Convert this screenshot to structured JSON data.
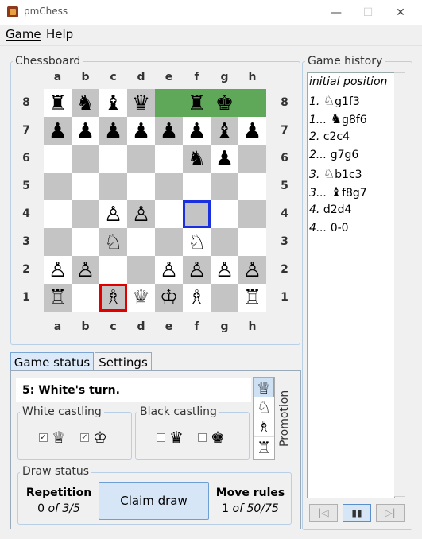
{
  "window": {
    "title": "pmChess",
    "minimize": "—",
    "maximize": "☐",
    "close": "✕"
  },
  "menu": {
    "game": "Game",
    "help": "Help"
  },
  "board": {
    "title": "Chessboard",
    "files": [
      "a",
      "b",
      "c",
      "d",
      "e",
      "f",
      "g",
      "h"
    ],
    "ranks": [
      "8",
      "7",
      "6",
      "5",
      "4",
      "3",
      "2",
      "1"
    ],
    "squares": [
      [
        "♜",
        "♞",
        "♝",
        "♛",
        "",
        "♜",
        "♚",
        ""
      ],
      [
        "♟",
        "♟",
        "♟",
        "♟",
        "♟",
        "♟",
        "♝",
        "♟"
      ],
      [
        "",
        "",
        "",
        "",
        "",
        "♞",
        "♟",
        ""
      ],
      [
        "",
        "",
        "",
        "",
        "",
        "",
        "",
        ""
      ],
      [
        "",
        "",
        "♙",
        "♙",
        "",
        "",
        "",
        ""
      ],
      [
        "",
        "",
        "♘",
        "",
        "",
        "♘",
        "",
        ""
      ],
      [
        "♙",
        "♙",
        "",
        "",
        "♙",
        "♙",
        "♙",
        "♙"
      ],
      [
        "♖",
        "",
        "♗",
        "♕",
        "♔",
        "♗",
        "",
        "♖"
      ]
    ],
    "highlight_green": [
      "e8",
      "f8",
      "g8",
      "h8"
    ],
    "selected_red": "c1",
    "selected_blue": "f4",
    "colors": {
      "light": "#ffffff",
      "dark": "#c4c4c4",
      "last_move": "#5fa85a",
      "selection": "#e00000",
      "target": "#1a2fe0"
    }
  },
  "history": {
    "title": "Game history",
    "rows": [
      {
        "num": "",
        "piece": "",
        "move": "initial position",
        "italic": true
      },
      {
        "num": "1.",
        "piece": "♘",
        "move": "g1f3"
      },
      {
        "num": "1...",
        "piece": "♞",
        "move": "g8f6"
      },
      {
        "num": "2.",
        "piece": "",
        "move": "c2c4"
      },
      {
        "num": "2...",
        "piece": "",
        "move": "g7g6"
      },
      {
        "num": "3.",
        "piece": "♘",
        "move": "b1c3"
      },
      {
        "num": "3...",
        "piece": "♝",
        "move": "f8g7"
      },
      {
        "num": "4.",
        "piece": "",
        "move": "d2d4"
      },
      {
        "num": "4...",
        "piece": "",
        "move": "0-0"
      }
    ],
    "nav_first": "|◁",
    "nav_pause": "▮▮",
    "nav_last": "▷|"
  },
  "tabs": {
    "game_status": "Game status",
    "settings": "Settings"
  },
  "status": {
    "turn": "5: White's turn.",
    "white_castling": {
      "label": "White castling",
      "queen": "♕",
      "king": "♔",
      "queen_checked": true,
      "king_checked": true
    },
    "black_castling": {
      "label": "Black castling",
      "queen": "♛",
      "king": "♚",
      "queen_checked": false,
      "king_checked": false
    },
    "promotion": {
      "label": "Promotion",
      "pieces": [
        "♕",
        "♘",
        "♗",
        "♖"
      ],
      "selected": 0
    },
    "draw": {
      "label": "Draw status",
      "repetition_label": "Repetition",
      "repetition_count": "0",
      "repetition_of": "of 3/5",
      "claim_button": "Claim draw",
      "move_rules_label": "Move rules",
      "move_rules_count": "1",
      "move_rules_of": "of 50/75"
    }
  }
}
